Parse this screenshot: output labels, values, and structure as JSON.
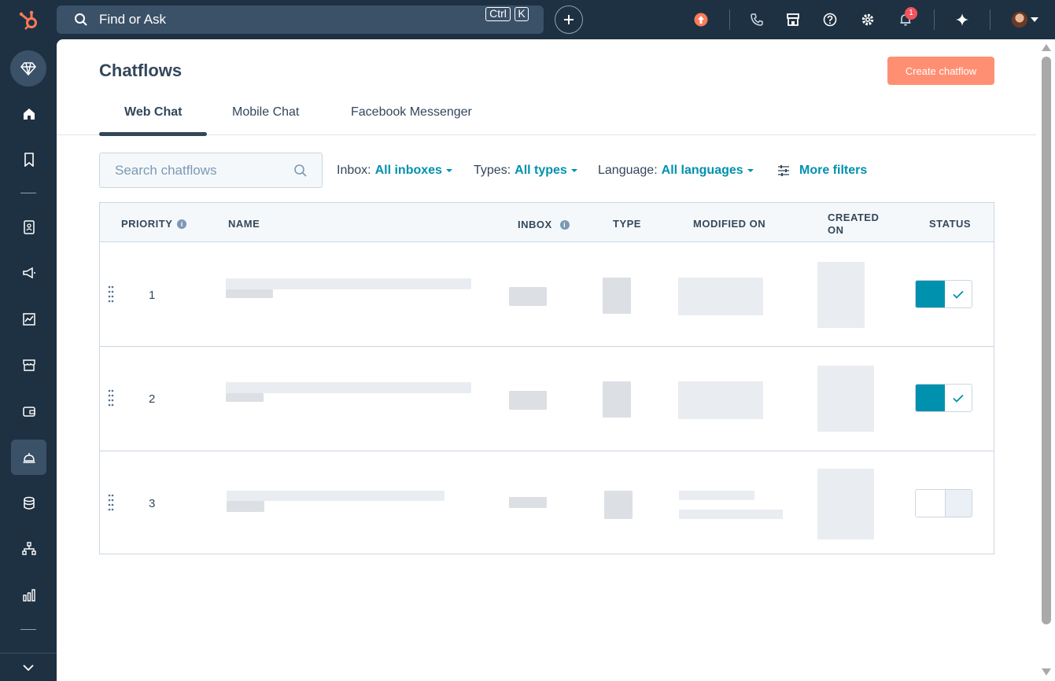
{
  "topbar": {
    "search_placeholder": "Find or Ask",
    "kbd_ctrl": "Ctrl",
    "kbd_k": "K",
    "notification_count": "1",
    "colors": {
      "bg": "#1e3142",
      "accent": "#ff7a59",
      "badge": "#f2545b"
    }
  },
  "sidebar": {
    "items": [
      "diamond-icon",
      "home-icon",
      "bookmark-icon",
      "contacts-icon",
      "megaphone-icon",
      "reports-icon",
      "store-icon",
      "wallet-icon",
      "help-desk-icon",
      "database-icon",
      "org-chart-icon",
      "bar-chart-icon"
    ],
    "active_item": "help-desk-icon"
  },
  "page": {
    "title": "Chatflows",
    "create_button": "Create chatflow",
    "tabs": [
      "Web Chat",
      "Mobile Chat",
      "Facebook Messenger"
    ],
    "active_tab": "Web Chat"
  },
  "filters": {
    "search_placeholder": "Search chatflows",
    "inbox_label": "Inbox:",
    "inbox_value": "All inboxes",
    "types_label": "Types:",
    "types_value": "All types",
    "language_label": "Language:",
    "language_value": "All languages",
    "more_filters": "More filters"
  },
  "table": {
    "columns": {
      "priority": "PRIORITY",
      "name": "NAME",
      "inbox": "INBOX",
      "type": "TYPE",
      "modified_on": "MODIFIED ON",
      "created_on": "CREATED ON",
      "status": "STATUS"
    },
    "rows": [
      {
        "priority": "1",
        "status_on": true
      },
      {
        "priority": "2",
        "status_on": true
      },
      {
        "priority": "3",
        "status_on": false
      }
    ]
  }
}
